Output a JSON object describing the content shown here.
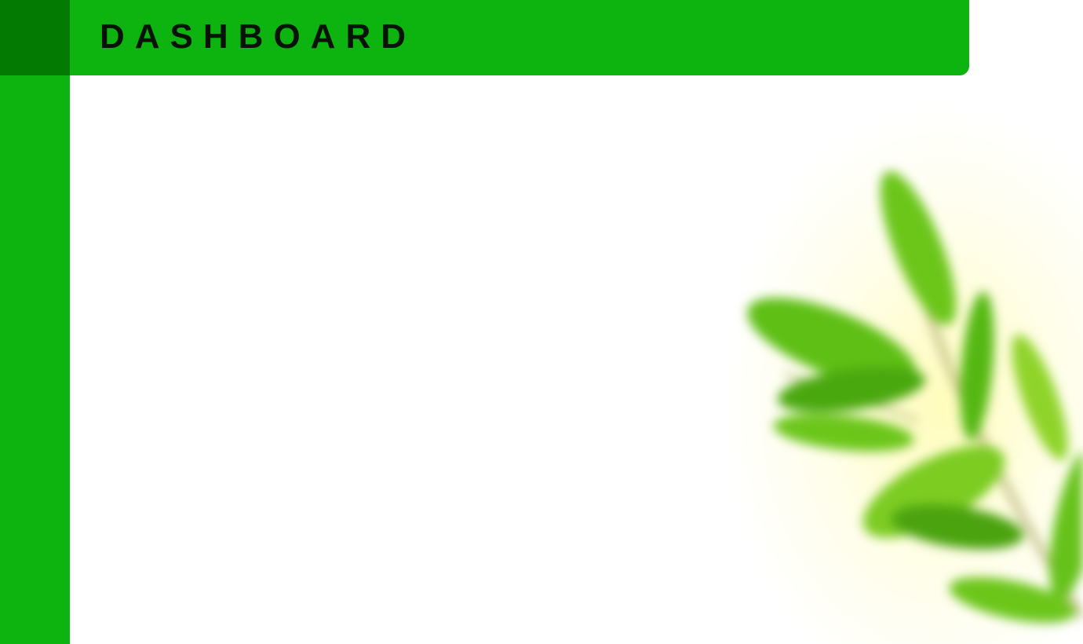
{
  "header": {
    "title": "DASHBOARD"
  },
  "colors": {
    "sidebar": "#0db30f",
    "sidebar_top": "#037a02",
    "header": "#0db30f",
    "title_text": "#071307",
    "background": "#ffffff"
  },
  "decoration": {
    "image": "blurred-green-leaves"
  }
}
